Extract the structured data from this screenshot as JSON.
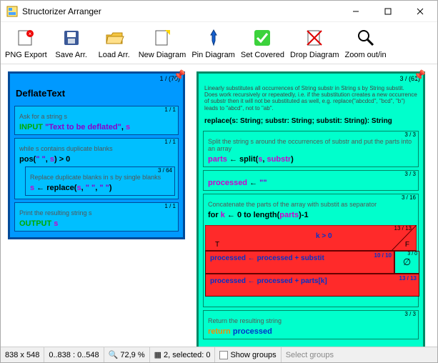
{
  "window": {
    "title": "Structorizer Arranger"
  },
  "toolbar": [
    {
      "label": "PNG Export"
    },
    {
      "label": "Save Arr."
    },
    {
      "label": "Load Arr."
    },
    {
      "label": "New Diagram"
    },
    {
      "label": "Pin Diagram"
    },
    {
      "label": "Set Covered"
    },
    {
      "label": "Drop Diagram"
    },
    {
      "label": "Zoom out/in"
    }
  ],
  "blue": {
    "hdr": "1 / (70)",
    "title": "DeflateText",
    "b1": {
      "hdr": "1 / 1",
      "cmt": "Ask for a string s",
      "kw": "INPUT",
      "str": "\"Text to be deflated\"",
      "var": "s"
    },
    "b2": {
      "hdr": "1 / 1",
      "cmt": "while s contains duplicate blanks",
      "code_pre": "pos(",
      "code_str": "\"  \"",
      "code_mid": ", ",
      "code_var": "s",
      "code_post": ") > 0"
    },
    "b3": {
      "hdr": "3 / 64",
      "cmt": "Replace duplicate blanks in s by single blanks",
      "lhs": "s",
      "arrow": " ← ",
      "call": "replace(",
      "a1": "s",
      "c1": ", ",
      "a2": "\"  \"",
      "c2": ", ",
      "a3": "\" \"",
      "end": ")"
    },
    "b4": {
      "hdr": "1 / 1",
      "cmt": "Print the resulting string s",
      "kw": "OUTPUT",
      "var": "s"
    }
  },
  "cyan": {
    "hdr": "3 / (61)",
    "desc": "Linearly substitutes all occurrences of String substr in String s by String substit. Does work recursively or repeatedly, i.e. if the substitution creates a new occurrence of substr then it will not be substituted as well, e.g. replace(\"abcdcd\", \"bcd\", \"b\") leads to \"abcd\", not to \"ab\".",
    "sig": "replace(s: String; substr: String; substit: String): String",
    "p1": {
      "hdr": "3 / 3",
      "cmt": "Split the string s around the occurrences of substr and put the parts into an array",
      "lhs": "parts",
      "arrow": " ← split(",
      "a1": "s",
      "c1": ", ",
      "a2": "substr",
      "end": ")"
    },
    "p2": {
      "hdr": "3 / 3",
      "lhs": "processed",
      "arrow": " ← ",
      "val": "\"\""
    },
    "p3": {
      "hdr": "3 / 16",
      "cmt": "Concatenate the parts of the array with substit as separator",
      "for": "for ",
      "kvar": "k",
      "mid": " ← 0 to length(",
      "pvar": "parts",
      "end": ")-1"
    },
    "cond": {
      "hdr": "13 / 13",
      "expr": "k > 0",
      "T": "T",
      "F": "F"
    },
    "r1": {
      "hdr": "10 / 10",
      "txt": "processed ← processed + substit"
    },
    "r0": {
      "hdr": "3 / 0",
      "sym": "∅"
    },
    "r2": {
      "hdr": "13 / 13",
      "txt": "processed ← processed + parts[k]"
    },
    "ret": {
      "hdr": "3 / 3",
      "cmt": "Return the resulting string",
      "kw": "return",
      "var": "processed"
    }
  },
  "status": {
    "dims": "838 x 548",
    "range": "0..838 : 0..548",
    "zoom": "72,9 %",
    "sel": "2, selected: 0",
    "showgroups": "Show groups",
    "selgroups": "Select groups"
  }
}
